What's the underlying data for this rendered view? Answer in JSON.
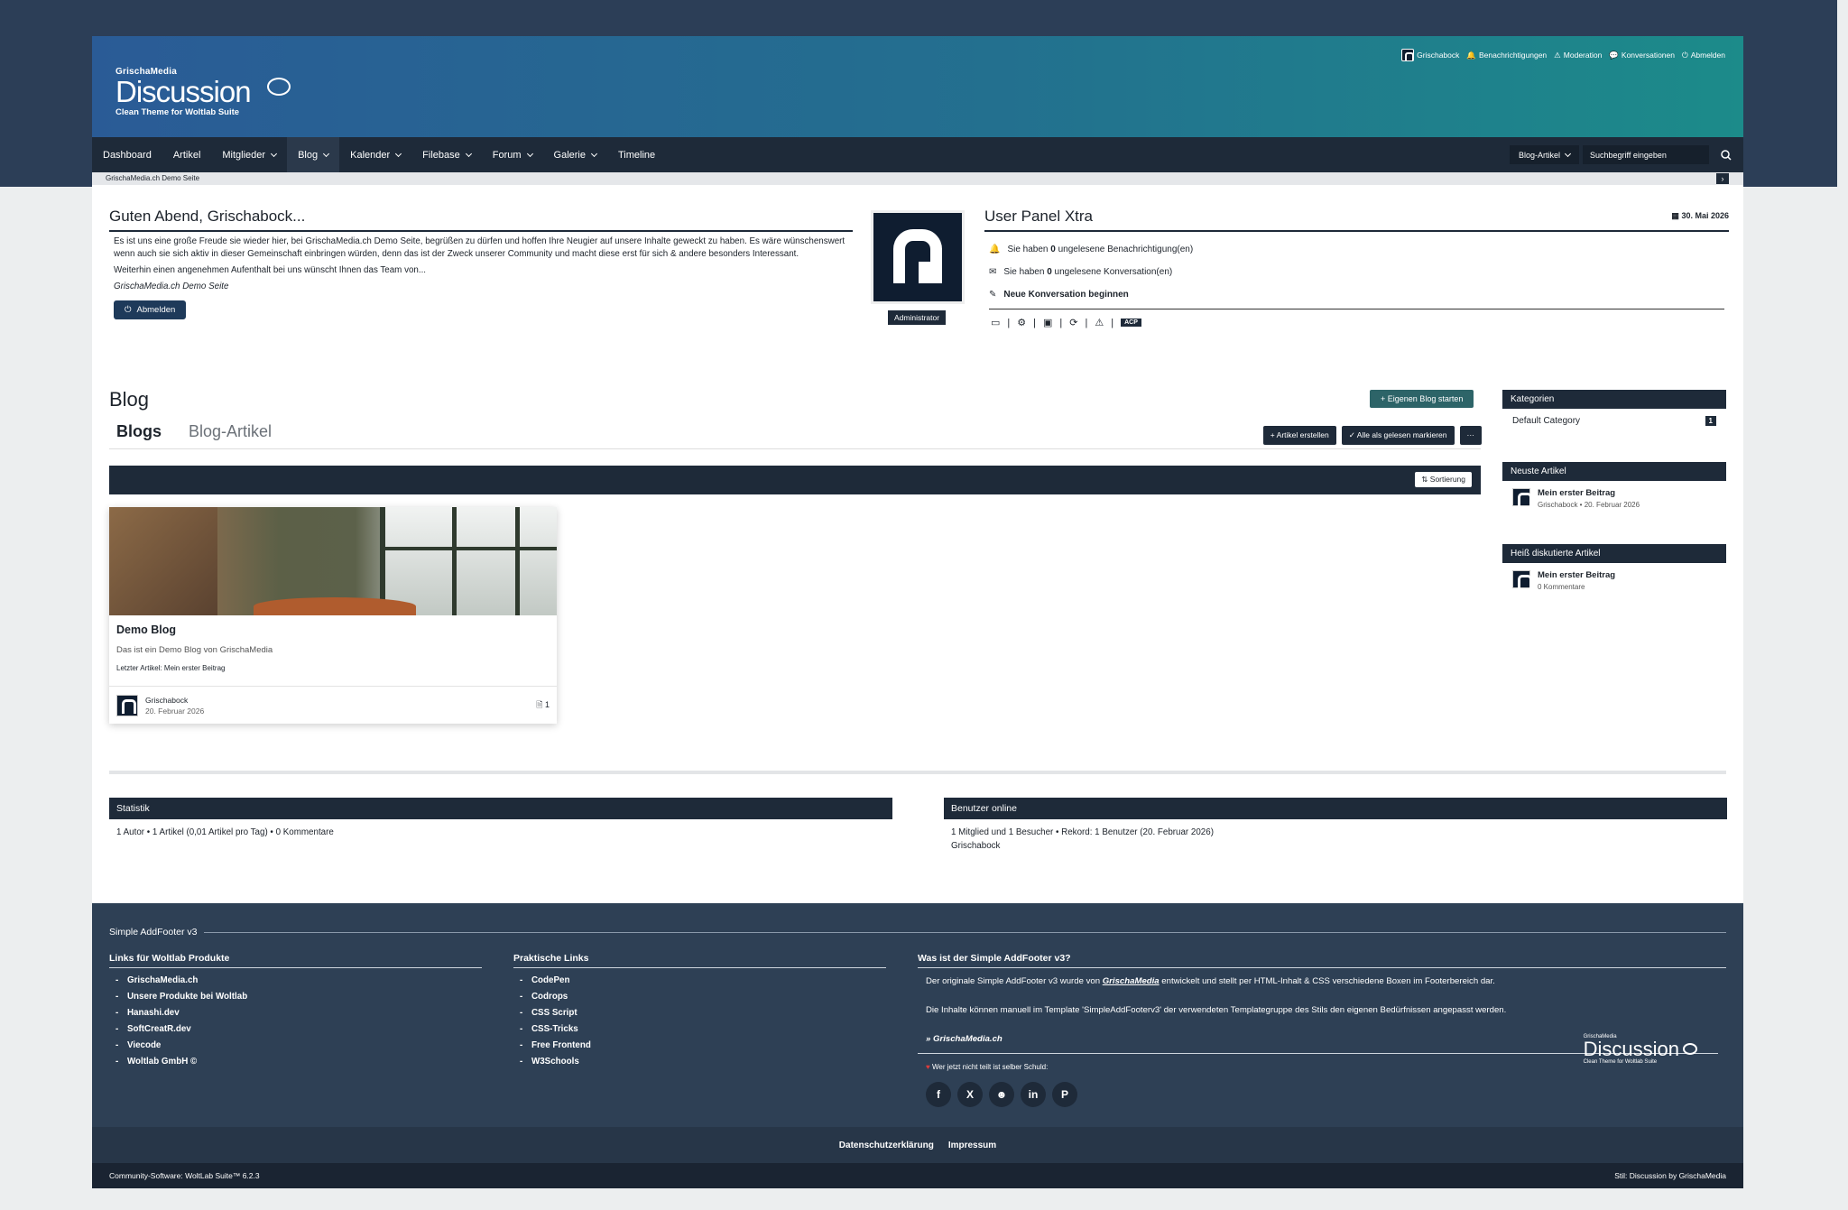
{
  "header": {
    "brand": "GrischaMedia",
    "name": "Discussion",
    "tagline": "Clean Theme for Woltlab Suite",
    "userbar": [
      "Grischabock",
      "Benachrichtigungen",
      "Moderation",
      "Konversationen",
      "Abmelden"
    ]
  },
  "nav": {
    "items": [
      {
        "label": "Dashboard"
      },
      {
        "label": "Artikel"
      },
      {
        "label": "Mitglieder"
      },
      {
        "label": "Blog"
      },
      {
        "label": "Kalender"
      },
      {
        "label": "Filebase"
      },
      {
        "label": "Forum"
      },
      {
        "label": "Galerie"
      },
      {
        "label": "Timeline"
      }
    ],
    "search_scope": "Blog-Artikel",
    "search_placeholder": "Suchbegriff eingeben"
  },
  "breadcrumb": "GrischaMedia.ch Demo Seite",
  "greeting": {
    "title": "Guten Abend, Grischabock...",
    "p1": "Es ist uns eine große Freude sie wieder hier, bei GrischaMedia.ch Demo Seite, begrüßen zu dürfen und hoffen Ihre Neugier auf unsere Inhalte geweckt zu haben. Es wäre wünschenswert wenn auch sie sich aktiv in dieser Gemeinschaft einbringen würden, denn das ist der Zweck unserer Community und macht diese erst für sich & andere besonders Interessant.",
    "p2": "Weiterhin einen angenehmen Aufenthalt bei uns wünscht Ihnen das Team von...",
    "signature": "GrischaMedia.ch Demo Seite",
    "logout": "Abmelden"
  },
  "avatar_badge": "Administrator",
  "user_panel": {
    "title": "User Panel Xtra",
    "date": "30. Mai 2026",
    "notif_pre": "Sie haben ",
    "notif_count": "0",
    "notif_post": " ungelesene Benachrichtigung(en)",
    "conv_pre": "Sie haben ",
    "conv_count": "0",
    "conv_post": " ungelesene Konversation(en)",
    "new_conv": "Neue Konversation beginnen",
    "acp": "ACP"
  },
  "blog": {
    "title": "Blog",
    "start_button": "Eigenen Blog starten",
    "tabs": [
      "Blogs",
      "Blog-Artikel"
    ],
    "actions": [
      "Artikel erstellen",
      "Alle als gelesen markieren",
      "···"
    ],
    "sort_label": "Sortierung",
    "card": {
      "title": "Demo Blog",
      "description": "Das ist ein Demo Blog von GrischaMedia",
      "last_article": "Letzter Artikel: Mein erster Beitrag",
      "author": "Grischabock",
      "date": "20. Februar 2026",
      "count": "1"
    }
  },
  "sidebar": {
    "categories_title": "Kategorien",
    "category": "Default Category",
    "category_count": "1",
    "latest_title": "Neuste Artikel",
    "latest_item": "Mein erster Beitrag",
    "latest_meta": "Grischabock • 20. Februar 2026",
    "hot_title": "Heiß diskutierte Artikel",
    "hot_item": "Mein erster Beitrag",
    "hot_meta": "0 Kommentare"
  },
  "stats": {
    "title": "Statistik",
    "text": "1 Autor • 1 Artikel (0,01 Artikel pro Tag) • 0 Kommentare"
  },
  "online": {
    "title": "Benutzer online",
    "text": "1 Mitglied und 1 Besucher • Rekord: 1 Benutzer (20. Februar 2026)",
    "user": "Grischabock"
  },
  "footer": {
    "title": "Simple AddFooter v3",
    "col1_title": "Links für Woltlab Produkte",
    "col1": [
      "GrischaMedia.ch",
      "Unsere Produkte bei Woltlab",
      "Hanashi.dev",
      "SoftCreatR.dev",
      "Viecode",
      "Woltlab GmbH ©"
    ],
    "col2_title": "Praktische Links",
    "col2": [
      "CodePen",
      "Codrops",
      "CSS Script",
      "CSS-Tricks",
      "Free Frontend",
      "W3Schools"
    ],
    "col3_title": "Was ist der Simple AddFooter v3?",
    "col3_p1_pre": "Der originale Simple AddFooter v3 wurde von ",
    "col3_p1_link": "GrischaMedia",
    "col3_p1_post": " entwickelt und stellt per HTML-Inhalt & CSS verschiedene Boxen im Footerbereich dar.",
    "col3_p2": "Die Inhalte können manuell im Template 'SimpleAddFooterv3' der verwendeten Templategruppe des Stils den eigenen Bedürfnissen angepasst werden.",
    "col3_link": "» GrischaMedia.ch",
    "share_text": "Wer jetzt nicht teilt ist selber Schuld:",
    "social_icons": [
      "facebook-icon",
      "x-icon",
      "reddit-icon",
      "linkedin-icon",
      "pinterest-icon"
    ],
    "social_glyphs": [
      "f",
      "X",
      "☻",
      "in",
      "P"
    ],
    "logo_brand": "GrischaMedia",
    "logo_name": "Discussion",
    "logo_tag": "Clean Theme for Woltlab Suite",
    "links": [
      "Datenschutzerklärung",
      "Impressum"
    ],
    "copyright": "Community-Software: WoltLab Suite™ 6.2.3",
    "style": "Stil: Discussion by GrischaMedia"
  },
  "colors": {
    "nav": "#1e2a39",
    "header_start": "#2a5b96",
    "header_end": "#1c8b8a",
    "footer": "#2e4055",
    "accent": "#2d6468"
  }
}
